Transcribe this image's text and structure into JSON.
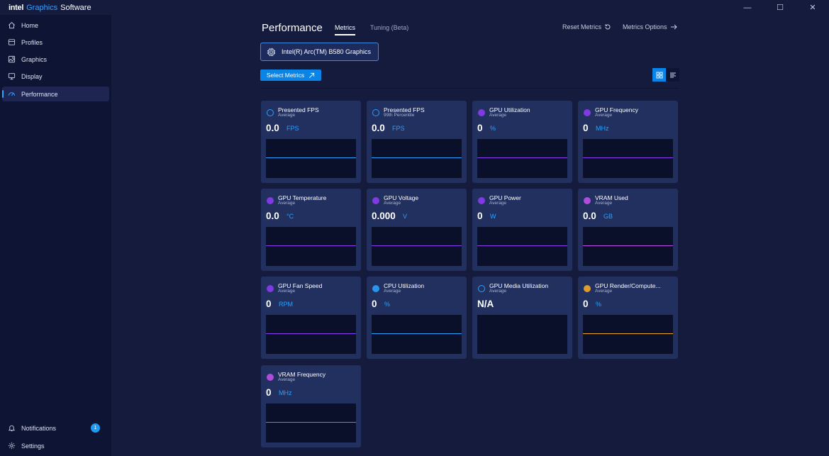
{
  "app": {
    "brand_intel": "intel",
    "brand_graphics": "Graphics",
    "brand_software": "Software",
    "window_controls": {
      "minimize": "—",
      "maximize": "☐",
      "close": "✕"
    }
  },
  "sidebar": {
    "items": [
      {
        "label": "Home",
        "icon": "home-icon"
      },
      {
        "label": "Profiles",
        "icon": "profiles-icon"
      },
      {
        "label": "Graphics",
        "icon": "graphics-icon"
      },
      {
        "label": "Display",
        "icon": "display-icon"
      },
      {
        "label": "Performance",
        "icon": "performance-icon",
        "active": true
      }
    ],
    "notifications": {
      "label": "Notifications",
      "count": "1"
    },
    "settings": {
      "label": "Settings"
    }
  },
  "header": {
    "title": "Performance",
    "tabs": [
      {
        "label": "Metrics",
        "active": true
      },
      {
        "label": "Tuning (Beta)"
      }
    ],
    "reset_label": "Reset Metrics",
    "options_label": "Metrics Options"
  },
  "gpu_selector": {
    "label": "Intel(R) Arc(TM) B580 Graphics"
  },
  "select_metrics_label": "Select Metrics",
  "colors": {
    "blue": "#2aa0ff",
    "purple": "#8a3df0",
    "magenta": "#c050e8",
    "orange": "#f0a828"
  },
  "metrics": [
    {
      "name": "Presented FPS",
      "sub": "Average",
      "value": "0.0",
      "unit": "FPS",
      "dot": "ring",
      "color": "#2aa0ff"
    },
    {
      "name": "Presented FPS",
      "sub": "99th Percentile",
      "value": "0.0",
      "unit": "FPS",
      "dot": "ring",
      "color": "#2aa0ff"
    },
    {
      "name": "GPU Utilization",
      "sub": "Average",
      "value": "0",
      "unit": "%",
      "dot": "fill",
      "color": "#8a3df0"
    },
    {
      "name": "GPU Frequency",
      "sub": "Average",
      "value": "0",
      "unit": "MHz",
      "dot": "fill",
      "color": "#8a3df0"
    },
    {
      "name": "GPU Temperature",
      "sub": "Average",
      "value": "0.0",
      "unit": "°C",
      "dot": "fill",
      "color": "#8a3df0"
    },
    {
      "name": "GPU Voltage",
      "sub": "Average",
      "value": "0.000",
      "unit": "V",
      "dot": "fill",
      "color": "#8a3df0"
    },
    {
      "name": "GPU Power",
      "sub": "Average",
      "value": "0",
      "unit": "W",
      "dot": "fill",
      "color": "#8a3df0"
    },
    {
      "name": "VRAM Used",
      "sub": "Average",
      "value": "0.0",
      "unit": "GB",
      "dot": "fill",
      "color": "#c050e8"
    },
    {
      "name": "GPU Fan Speed",
      "sub": "Average",
      "value": "0",
      "unit": "RPM",
      "dot": "fill",
      "color": "#8a3df0"
    },
    {
      "name": "CPU Utilization",
      "sub": "Average",
      "value": "0",
      "unit": "%",
      "dot": "fill",
      "color": "#2aa0ff"
    },
    {
      "name": "GPU Media Utilization",
      "sub": "Average",
      "value": "N/A",
      "unit": "",
      "dot": "ring",
      "color": "#2aa0ff",
      "no_line": true
    },
    {
      "name": "GPU Render/Compute...",
      "sub": "Average",
      "value": "0",
      "unit": "%",
      "dot": "fill",
      "color": "#f0a828"
    },
    {
      "name": "VRAM Frequency",
      "sub": "Average",
      "value": "0",
      "unit": "MHz",
      "dot": "fill",
      "color": "#c050e8"
    }
  ]
}
